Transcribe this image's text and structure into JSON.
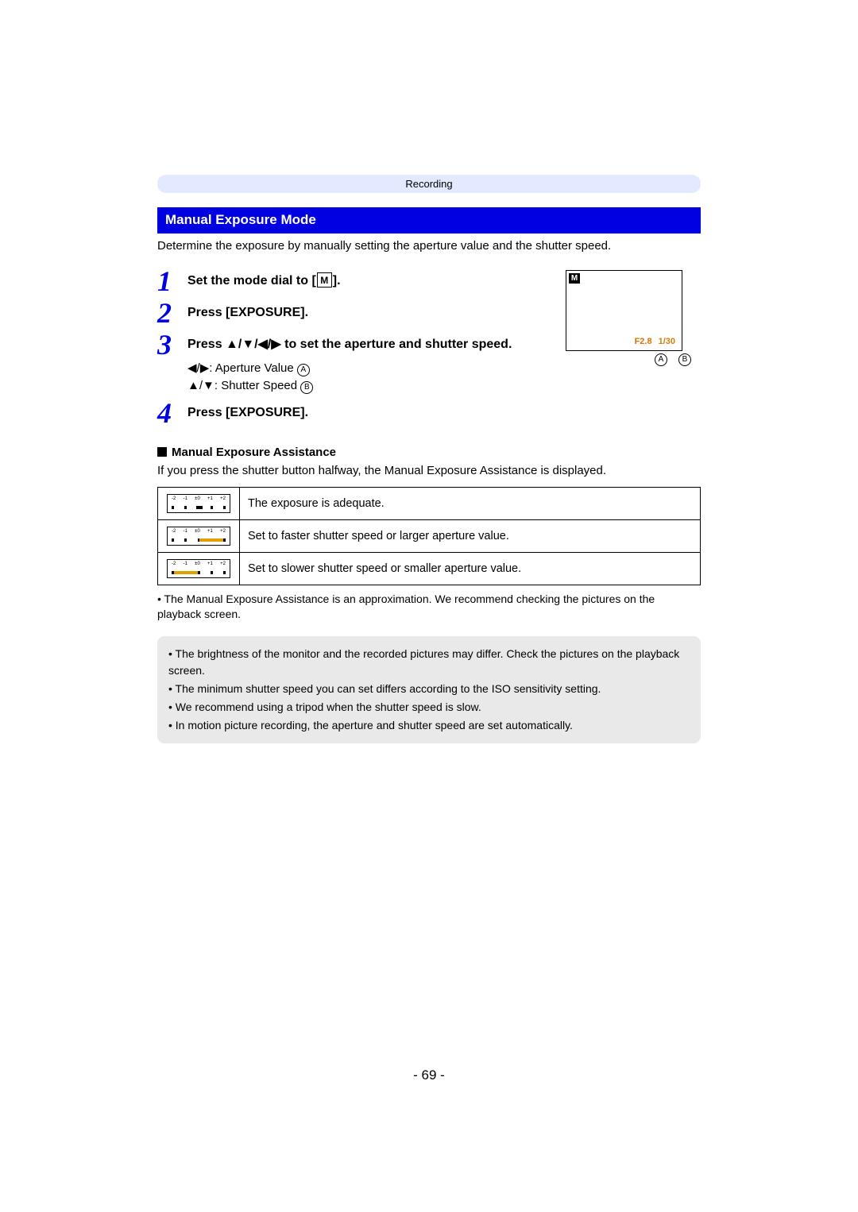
{
  "breadcrumb": "Recording",
  "section_title": "Manual Exposure Mode",
  "intro": "Determine the exposure by manually setting the aperture value and the shutter speed.",
  "steps": {
    "s1": {
      "num": "1",
      "text_a": "Set the mode dial to [",
      "text_b": "]."
    },
    "s2": {
      "num": "2",
      "text": "Press [EXPOSURE]."
    },
    "s3": {
      "num": "3",
      "text_a": "Press ",
      "arrows": "▲/▼/◀/▶",
      "text_b": " to set the aperture and shutter speed.",
      "sub_a_pre": "◀/▶",
      "sub_a_label": ": Aperture Value ",
      "sub_a_circ": "A",
      "sub_b_pre": "▲/▼",
      "sub_b_label": ": Shutter Speed ",
      "sub_b_circ": "B"
    },
    "s4": {
      "num": "4",
      "text": "Press [EXPOSURE]."
    }
  },
  "screen": {
    "m": "M",
    "val_a": "F2.8",
    "val_b": "1/30",
    "label_a": "A",
    "label_b": "B"
  },
  "assist": {
    "heading": "Manual Exposure Assistance",
    "intro": "If you press the shutter button halfway, the Manual Exposure Assistance is displayed.",
    "rows": [
      "The exposure is adequate.",
      "Set to faster shutter speed or larger aperture value.",
      "Set to slower shutter speed or smaller aperture value."
    ],
    "ticks": [
      "-2",
      "-1",
      "±0",
      "+1",
      "+2"
    ],
    "footnote": "The Manual Exposure Assistance is an approximation. We recommend checking the pictures on the playback screen."
  },
  "notes": [
    "The brightness of the monitor and the recorded pictures may differ. Check the pictures on the playback screen.",
    "The minimum shutter speed you can set differs according to the ISO sensitivity setting.",
    "We recommend using a tripod when the shutter speed is slow.",
    "In motion picture recording, the aperture and shutter speed are set automatically."
  ],
  "page_number": "- 69 -",
  "bullet": "•"
}
